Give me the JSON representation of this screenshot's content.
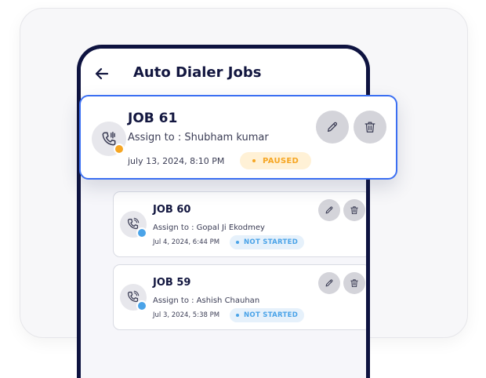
{
  "header": {
    "title": "Auto Dialer Jobs"
  },
  "featured_job": {
    "title": "JOB 61",
    "assign": "Assign to : Shubham kumar",
    "date": "july 13, 2024, 8:10 PM",
    "status": "PAUSED",
    "status_color": "#f6a623"
  },
  "jobs": [
    {
      "title": "JOB  60",
      "assign": "Assign to : Gopal Ji Ekodmey",
      "date": "Jul 4, 2024, 6:44 PM",
      "status": "NOT STARTED",
      "status_color": "#4aa3e8"
    },
    {
      "title": "JOB  59",
      "assign": "Assign to : Ashish Chauhan",
      "date": "Jul 3, 2024, 5:38 PM",
      "status": "NOT STARTED",
      "status_color": "#4aa3e8"
    }
  ],
  "icons": {
    "back": "arrow-left-icon",
    "call": "phone-call-icon",
    "edit": "pencil-icon",
    "delete": "trash-icon"
  },
  "colors": {
    "accent": "#3b6ff2",
    "navy": "#12163f",
    "paused_bg": "#fff1d6",
    "not_started_bg": "#e6f1fb"
  }
}
